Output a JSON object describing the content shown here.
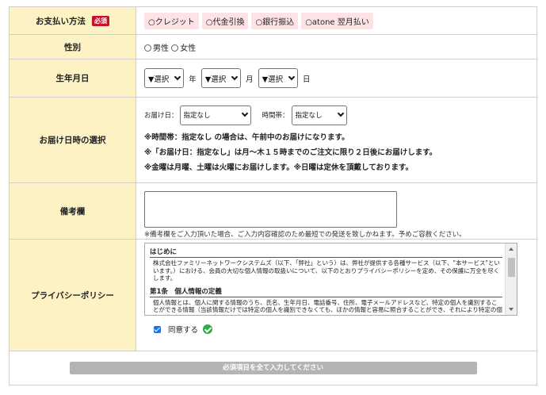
{
  "payment": {
    "label": "お支払い方法",
    "required": "必須",
    "options": [
      "○クレジット",
      "○代金引換",
      "○銀行振込",
      "○atone 翌月払い"
    ]
  },
  "gender": {
    "label": "性別",
    "options": [
      "男性",
      "女性"
    ]
  },
  "birthdate": {
    "label": "生年月日",
    "select_default": "▼選択",
    "year_unit": "年",
    "month_unit": "月",
    "day_unit": "日"
  },
  "delivery": {
    "label": "お届け日時の選択",
    "date_label": "お届け日：",
    "date_value": "指定なし",
    "time_label": "時間帯：",
    "time_value": "指定なし",
    "notes": [
      "※時間帯：指定なし の場合は、午前中のお届けになります。",
      "※「お届け日：指定なし」は月～木１５時までのご注文に限り２日後にお届けします。",
      "※金曜は月曜、土曜は火曜にお届けします。※日曜は定休を頂戴しております。"
    ]
  },
  "remarks": {
    "label": "備考欄",
    "note": "※備考欄をご入力頂いた場合、ご入力内容確認のため最短での発送を致しかねます。予めご容赦ください。"
  },
  "privacy": {
    "label": "プライバシーポリシー",
    "sections": [
      {
        "title": "はじめに",
        "text": "株式会社ファミリーネットワークシステムズ（以下、「弊社」という）は、弊社が提供する各種サービス（以下、\"本サービス\"といいます。）における、会員の大切な個人情報の取扱いについて、以下のとおりプライバシーポリシーを定め、その保護に万全を尽くします。"
      },
      {
        "title": "第1条　個人情報の定義",
        "text": "個人情報とは、個人に関する情報のうち、氏名、生年月日、電話番号、住所、電子メールアドレスなど、特定の個人を識別することができる情報（当該情報だけでは特定の個人を識別できなくても、ほかの情報と容易に照合することができ、それにより特定の個人を識別できるものを含みます。）をいいます。"
      }
    ],
    "agree_label": "同意する"
  },
  "submit": {
    "label": "必須項目を全て入力してください"
  },
  "colors": {
    "label_bg": "#fdf2c4",
    "required_badge": "#c8102e",
    "payment_option_bg": "#fde2e6",
    "ok_green": "#2eaa4a",
    "checkbox_blue": "#1a73e8",
    "submit_disabled": "#b4b4b4"
  }
}
